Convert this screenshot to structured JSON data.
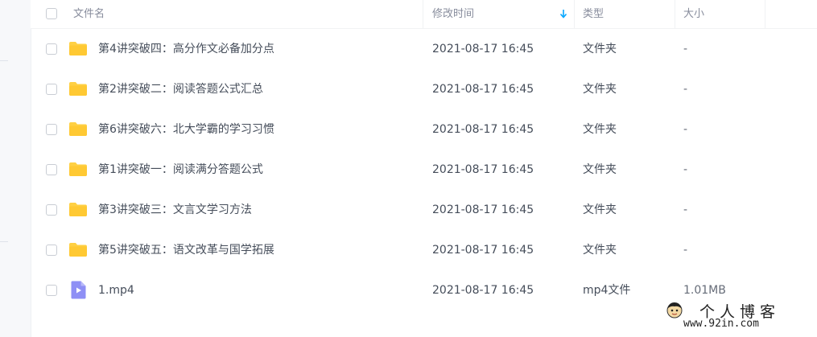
{
  "header": {
    "name_label": "文件名",
    "mtime_label": "修改时间",
    "type_label": "类型",
    "size_label": "大小",
    "sort_icon": "arrow-down-icon"
  },
  "files": [
    {
      "name": "第4讲突破四：高分作文必备加分点",
      "mtime": "2021-08-17 16:45",
      "type": "文件夹",
      "size": "-",
      "icon": "folder-icon"
    },
    {
      "name": "第2讲突破二：阅读答题公式汇总",
      "mtime": "2021-08-17 16:45",
      "type": "文件夹",
      "size": "-",
      "icon": "folder-icon"
    },
    {
      "name": "第6讲突破六：北大学霸的学习习惯",
      "mtime": "2021-08-17 16:45",
      "type": "文件夹",
      "size": "-",
      "icon": "folder-icon"
    },
    {
      "name": "第1讲突破一：阅读满分答题公式",
      "mtime": "2021-08-17 16:45",
      "type": "文件夹",
      "size": "-",
      "icon": "folder-icon"
    },
    {
      "name": "第3讲突破三：文言文学习方法",
      "mtime": "2021-08-17 16:45",
      "type": "文件夹",
      "size": "-",
      "icon": "folder-icon"
    },
    {
      "name": "第5讲突破五：语文改革与国学拓展",
      "mtime": "2021-08-17 16:45",
      "type": "文件夹",
      "size": "-",
      "icon": "folder-icon"
    },
    {
      "name": "1.mp4",
      "mtime": "2021-08-17 16:45",
      "type": "mp4文件",
      "size": "1.01MB",
      "icon": "video-file-icon"
    }
  ],
  "watermark": {
    "title": "个人博客",
    "url": "www.92in.com"
  },
  "colors": {
    "accent": "#06a7ff",
    "folder": "#ffd043",
    "video": "#8e8ff5",
    "header_text": "#878c9c",
    "row_text": "#454d5a"
  }
}
